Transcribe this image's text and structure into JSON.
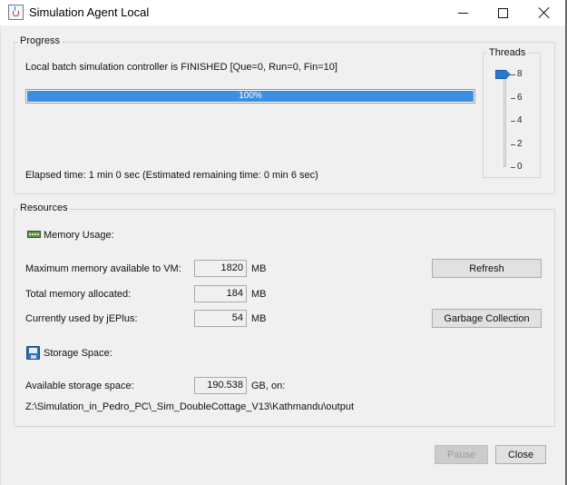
{
  "window": {
    "title": "Simulation Agent Local",
    "icon": "java-cup-icon"
  },
  "progress": {
    "group_title": "Progress",
    "status_text": "Local batch simulation controller is FINISHED [Que=0, Run=0, Fin=10]",
    "percent": 100,
    "percent_label": "100%",
    "elapsed_text": "Elapsed time: 1 min 0 sec (Estimated remaining time: 0 min 6 sec)"
  },
  "threads": {
    "title": "Threads",
    "value": 8,
    "ticks": [
      "8",
      "6",
      "4",
      "2",
      "0"
    ]
  },
  "resources": {
    "group_title": "Resources",
    "memory_heading": "Memory Usage:",
    "max_memory_label": "Maximum memory available to VM:",
    "max_memory_value": "1820",
    "max_memory_unit": "MB",
    "total_memory_label": "Total memory allocated:",
    "total_memory_value": "184",
    "total_memory_unit": "MB",
    "used_memory_label": "Currently used by jEPlus:",
    "used_memory_value": "54",
    "used_memory_unit": "MB",
    "refresh_label": "Refresh",
    "gc_label": "Garbage Collection",
    "storage_heading": "Storage Space:",
    "storage_label": "Available storage space:",
    "storage_value": "190.538",
    "storage_unit": "GB, on:",
    "storage_path": "Z:\\Simulation_in_Pedro_PC\\_Sim_DoubleCottage_V13\\Kathmandu\\output"
  },
  "footer": {
    "pause_label": "Pause",
    "close_label": "Close"
  },
  "colors": {
    "accent": "#3b8ee0",
    "window_bg": "#f0f0f0"
  }
}
